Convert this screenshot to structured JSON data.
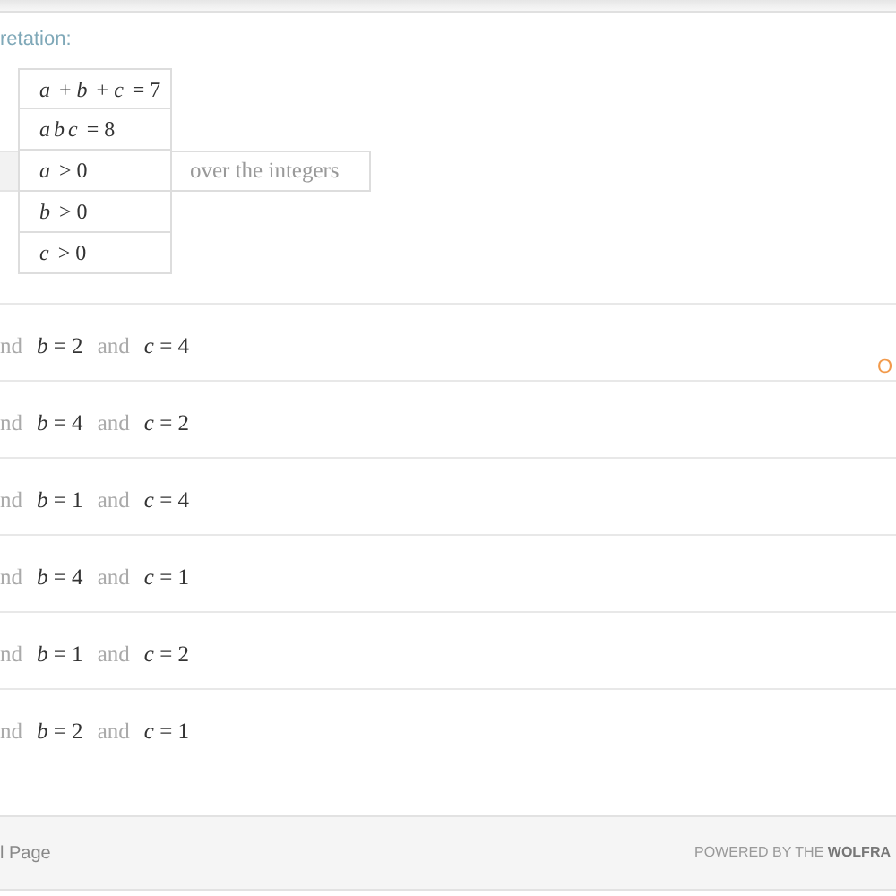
{
  "input_heading": "retation:",
  "conditions": [
    {
      "text": "a + b + c = 7"
    },
    {
      "text": "a b c = 8"
    },
    {
      "text": "a > 0",
      "note": "over the integers"
    },
    {
      "text": "b > 0"
    },
    {
      "text": "c > 0"
    }
  ],
  "solutions": [
    {
      "parts": [
        {
          "kind": "word",
          "text": "nd"
        },
        {
          "kind": "math",
          "text": "*b* = 2"
        },
        {
          "kind": "word",
          "text": "and"
        },
        {
          "kind": "math",
          "text": "*c* = 4"
        }
      ],
      "side_link": "O"
    },
    {
      "parts": [
        {
          "kind": "word",
          "text": "nd"
        },
        {
          "kind": "math",
          "text": "*b* = 4"
        },
        {
          "kind": "word",
          "text": "and"
        },
        {
          "kind": "math",
          "text": "*c* = 2"
        }
      ]
    },
    {
      "parts": [
        {
          "kind": "word",
          "text": "nd"
        },
        {
          "kind": "math",
          "text": "*b* = 1"
        },
        {
          "kind": "word",
          "text": "and"
        },
        {
          "kind": "math",
          "text": "*c* = 4"
        }
      ]
    },
    {
      "parts": [
        {
          "kind": "word",
          "text": "nd"
        },
        {
          "kind": "math",
          "text": "*b* = 4"
        },
        {
          "kind": "word",
          "text": "and"
        },
        {
          "kind": "math",
          "text": "*c* = 1"
        }
      ]
    },
    {
      "parts": [
        {
          "kind": "word",
          "text": "nd"
        },
        {
          "kind": "math",
          "text": "*b* = 1"
        },
        {
          "kind": "word",
          "text": "and"
        },
        {
          "kind": "math",
          "text": "*c* = 2"
        }
      ]
    },
    {
      "parts": [
        {
          "kind": "word",
          "text": "nd"
        },
        {
          "kind": "math",
          "text": "*b* = 2"
        },
        {
          "kind": "word",
          "text": "and"
        },
        {
          "kind": "math",
          "text": "*c* = 1"
        }
      ]
    }
  ],
  "footer": {
    "link": "l Page",
    "powered": "POWERED BY THE **WOLFRA**"
  }
}
